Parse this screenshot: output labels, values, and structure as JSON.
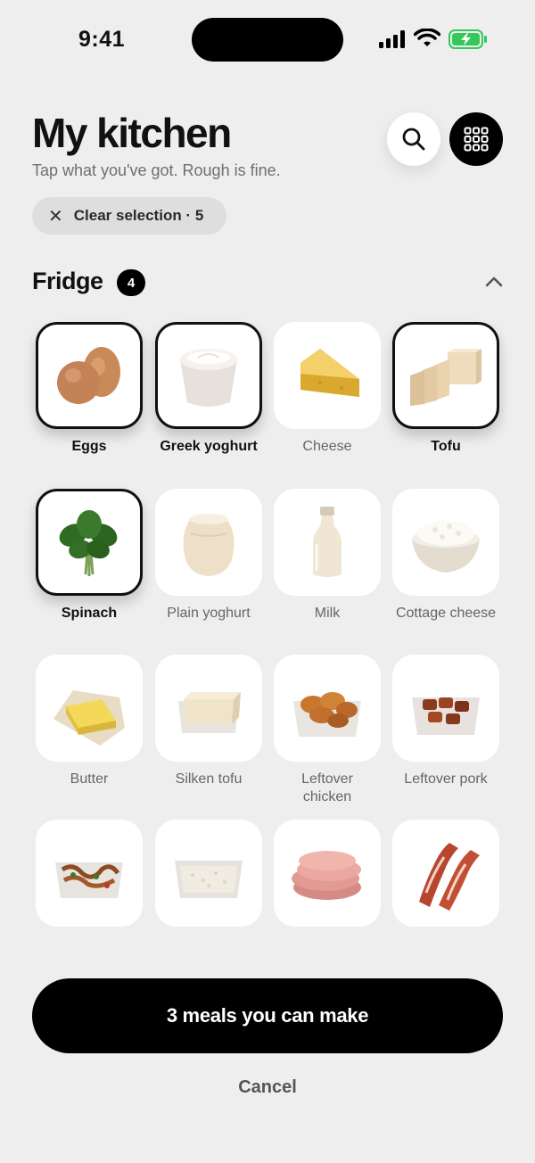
{
  "status_bar": {
    "time": "9:41",
    "icons": [
      "signal-icon",
      "wifi-icon",
      "battery-charging-icon"
    ],
    "battery_color": "#34c759"
  },
  "header": {
    "title": "My kitchen",
    "subtitle": "Tap what you've got. Rough is fine.",
    "search_icon": "search-icon",
    "view_icon": "grid-icon"
  },
  "clear_chip": {
    "label": "Clear selection · 5",
    "icon": "close-icon"
  },
  "section": {
    "title": "Fridge",
    "count": "4",
    "toggle_icon": "chevron-up-icon"
  },
  "items": [
    {
      "label": "Eggs",
      "selected": true,
      "icon": "eggs-icon"
    },
    {
      "label": "Greek yoghurt",
      "selected": true,
      "icon": "greek-yoghurt-icon"
    },
    {
      "label": "Cheese",
      "selected": false,
      "icon": "cheese-icon"
    },
    {
      "label": "Tofu",
      "selected": true,
      "icon": "tofu-icon"
    },
    {
      "label": "Spinach",
      "selected": true,
      "icon": "spinach-icon"
    },
    {
      "label": "Plain yoghurt",
      "selected": false,
      "icon": "plain-yoghurt-icon"
    },
    {
      "label": "Milk",
      "selected": false,
      "icon": "milk-icon"
    },
    {
      "label": "Cottage cheese",
      "selected": false,
      "icon": "cottage-cheese-icon"
    },
    {
      "label": "Butter",
      "selected": false,
      "icon": "butter-icon"
    },
    {
      "label": "Silken tofu",
      "selected": false,
      "icon": "silken-tofu-icon"
    },
    {
      "label": "Leftover chicken",
      "selected": false,
      "icon": "leftover-chicken-icon"
    },
    {
      "label": "Leftover pork",
      "selected": false,
      "icon": "leftover-pork-icon"
    },
    {
      "label": "",
      "selected": false,
      "icon": "leftover-stir-fry-icon"
    },
    {
      "label": "",
      "selected": false,
      "icon": "rice-container-icon"
    },
    {
      "label": "",
      "selected": false,
      "icon": "ham-icon"
    },
    {
      "label": "",
      "selected": false,
      "icon": "bacon-icon"
    }
  ],
  "cta": {
    "label": "3 meals you can make"
  },
  "cancel": {
    "label": "Cancel"
  }
}
